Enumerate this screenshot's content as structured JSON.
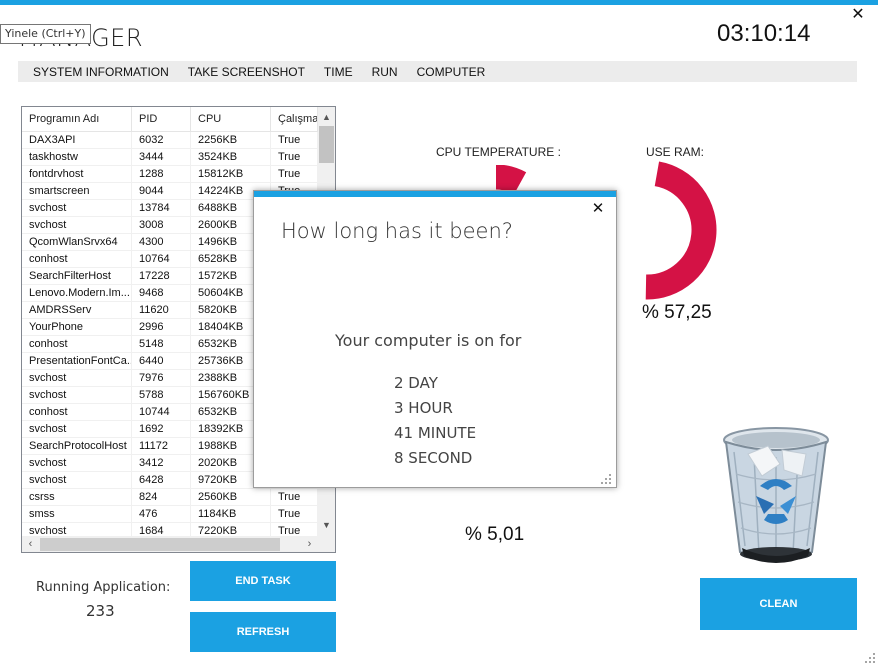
{
  "window": {
    "title": "MANAGER",
    "tooltip": "Yinele (Ctrl+Y)",
    "clock": "03:10:14",
    "close_glyph": "✕",
    "accent_color": "#1ba1e2"
  },
  "menu": [
    {
      "label": "SYSTEM INFORMATION"
    },
    {
      "label": "TAKE SCREENSHOT"
    },
    {
      "label": "TIME"
    },
    {
      "label": "RUN"
    },
    {
      "label": "COMPUTER"
    }
  ],
  "process_grid": {
    "columns": [
      "Programın Adı",
      "PID",
      "CPU",
      "Çalışma"
    ],
    "rows": [
      [
        "DAX3API",
        "6032",
        "2256KB",
        "True"
      ],
      [
        "taskhostw",
        "3444",
        "3524KB",
        "True"
      ],
      [
        "fontdrvhost",
        "1288",
        "15812KB",
        "True"
      ],
      [
        "smartscreen",
        "9044",
        "14224KB",
        "True"
      ],
      [
        "svchost",
        "13784",
        "6488KB",
        ""
      ],
      [
        "svchost",
        "3008",
        "2600KB",
        ""
      ],
      [
        "QcomWlanSrvx64",
        "4300",
        "1496KB",
        ""
      ],
      [
        "conhost",
        "10764",
        "6528KB",
        ""
      ],
      [
        "SearchFilterHost",
        "17228",
        "1572KB",
        ""
      ],
      [
        "Lenovo.Modern.Im...",
        "9468",
        "50604KB",
        ""
      ],
      [
        "AMDRSServ",
        "11620",
        "5820KB",
        ""
      ],
      [
        "YourPhone",
        "2996",
        "18404KB",
        ""
      ],
      [
        "conhost",
        "5148",
        "6532KB",
        ""
      ],
      [
        "PresentationFontCa...",
        "6440",
        "25736KB",
        ""
      ],
      [
        "svchost",
        "7976",
        "2388KB",
        ""
      ],
      [
        "svchost",
        "5788",
        "156760KB",
        ""
      ],
      [
        "conhost",
        "10744",
        "6532KB",
        ""
      ],
      [
        "svchost",
        "1692",
        "18392KB",
        ""
      ],
      [
        "SearchProtocolHost",
        "11172",
        "1988KB",
        ""
      ],
      [
        "svchost",
        "3412",
        "2020KB",
        ""
      ],
      [
        "svchost",
        "6428",
        "9720KB",
        ""
      ],
      [
        "csrss",
        "824",
        "2560KB",
        "True"
      ],
      [
        "smss",
        "476",
        "1184KB",
        "True"
      ],
      [
        "svchost",
        "1684",
        "7220KB",
        "True"
      ]
    ]
  },
  "running": {
    "label": "Running Application:",
    "count": "233"
  },
  "buttons": {
    "end_task": "END TASK",
    "refresh": "REFRESH",
    "clean": "CLEAN"
  },
  "cpu": {
    "label": "CPU TEMPERATURE :",
    "percent_text": "% 5,01",
    "percent": 5.01
  },
  "ram": {
    "label": "USE RAM:",
    "percent_text": "% 57,25",
    "percent": 57.25,
    "gauge_color": "#d41245"
  },
  "dialog": {
    "title": "How long has it been?",
    "subtitle": "Your computer is on for",
    "lines": [
      "2 DAY",
      "3 HOUR",
      "41 MINUTE",
      "8 SECOND"
    ]
  }
}
